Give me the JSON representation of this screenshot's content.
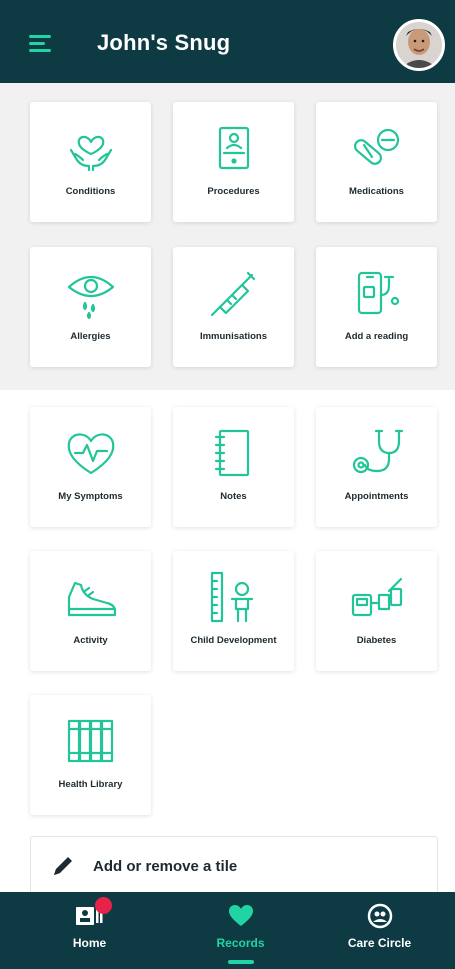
{
  "header": {
    "title": "John's Snug"
  },
  "tiles_section_1": [
    {
      "label": "Conditions",
      "icon": "heart-hands-icon"
    },
    {
      "label": "Procedures",
      "icon": "clipboard-icon"
    },
    {
      "label": "Medications",
      "icon": "pills-icon"
    },
    {
      "label": "Allergies",
      "icon": "eye-drops-icon"
    },
    {
      "label": "Immunisations",
      "icon": "syringe-icon"
    },
    {
      "label": "Add a reading",
      "icon": "phone-stethoscope-icon"
    }
  ],
  "tiles_section_2": [
    {
      "label": "My Symptoms",
      "icon": "heart-pulse-icon"
    },
    {
      "label": "Notes",
      "icon": "notebook-icon"
    },
    {
      "label": "Appointments",
      "icon": "stethoscope-icon"
    },
    {
      "label": "Activity",
      "icon": "shoe-icon"
    },
    {
      "label": "Child Development",
      "icon": "child-ruler-icon"
    },
    {
      "label": "Diabetes",
      "icon": "glucose-meter-icon"
    },
    {
      "label": "Health Library",
      "icon": "books-icon"
    }
  ],
  "add_tile": {
    "label": "Add or remove a tile",
    "icon": "pencil-icon"
  },
  "bottom_nav": [
    {
      "label": "Home",
      "icon": "home-card-icon",
      "badge": true
    },
    {
      "label": "Records",
      "icon": "heart-icon",
      "active": true
    },
    {
      "label": "Care Circle",
      "icon": "care-circle-icon"
    }
  ],
  "colors": {
    "header_bg": "#0e3a43",
    "accent": "#22d3a3",
    "badge": "#e8214a"
  }
}
